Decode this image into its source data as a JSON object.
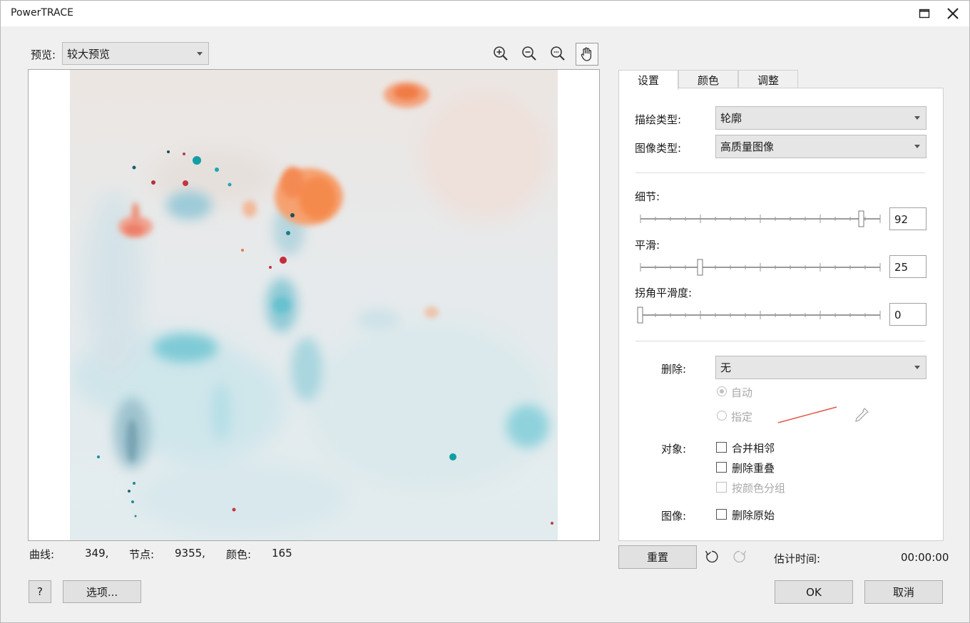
{
  "window": {
    "title": "PowerTRACE"
  },
  "preview": {
    "label": "预览:",
    "mode": "较大预览"
  },
  "stats": {
    "curves_label": "曲线:",
    "curves_value": "349,",
    "nodes_label": "节点:",
    "nodes_value": "9355,",
    "colors_label": "颜色:",
    "colors_value": "165"
  },
  "tabs": [
    "设置",
    "颜色",
    "调整"
  ],
  "settings": {
    "trace_type_label": "描绘类型:",
    "trace_type_value": "轮廓",
    "image_type_label": "图像类型:",
    "image_type_value": "高质量图像",
    "detail_label": "细节:",
    "detail_value": "92",
    "smooth_label": "平滑:",
    "smooth_value": "25",
    "corner_label": "拐角平滑度:",
    "corner_value": "0",
    "remove_label": "删除:",
    "remove_value": "无",
    "auto_label": "自动",
    "specify_label": "指定",
    "objects_label": "对象:",
    "merge_adjacent": "合并相邻",
    "remove_overlap": "删除重叠",
    "group_by_color": "按颜色分组",
    "image_label": "图像:",
    "delete_original": "删除原始"
  },
  "buttons": {
    "help": "?",
    "options": "选项...",
    "reset": "重置",
    "ok": "OK",
    "cancel": "取消"
  },
  "estimate": {
    "label": "估计时间:",
    "value": "00:00:00"
  },
  "colors": {
    "accent": "#f07a45",
    "swatch_line": "#e0584a"
  },
  "icons": [
    "zoom-in-icon",
    "zoom-out-icon",
    "zoom-fit-icon",
    "pan-hand-icon",
    "undo-icon",
    "redo-icon",
    "eyedropper-icon",
    "maximize-icon",
    "close-icon"
  ]
}
